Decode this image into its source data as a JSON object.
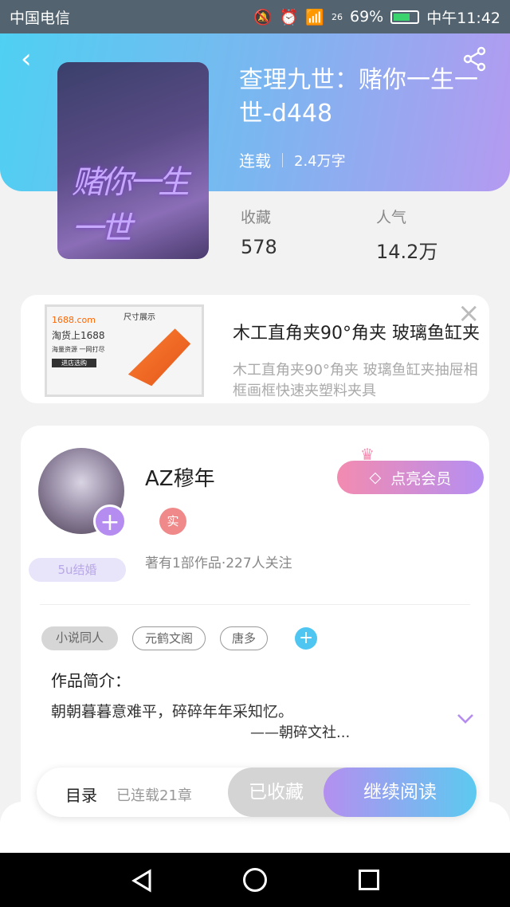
{
  "status_bar": {
    "carrier": "中国电信",
    "network": "26",
    "battery": "69%",
    "time": "中午11:42"
  },
  "book": {
    "title": "查理九世：赌你一生一世-d448",
    "status": "连载",
    "word_count": "2.4万字",
    "cover_text": "赌你一生一世"
  },
  "stats": {
    "favorites_label": "收藏",
    "favorites_value": "578",
    "popularity_label": "人气",
    "popularity_value": "14.2万"
  },
  "ad": {
    "image_brand": "1688.com",
    "image_headline": "淘货上1688",
    "image_sub": "海量资源 一网打尽",
    "image_button": "进店选购",
    "image_caption": "尺寸展示",
    "title": "木工直角夹90°角夹 玻璃鱼缸夹",
    "description": "木工直角夹90°角夹 玻璃鱼缸夹抽屉相框画框快速夹塑料夹具"
  },
  "author": {
    "name": "AZ穆年",
    "verified_badge": "实",
    "badge_5u": "5u结婚",
    "vip_button": "点亮会员",
    "works_info": "著有1部作品·227人关注"
  },
  "tags": [
    "小说同人",
    "元鹤文阁",
    "唐多"
  ],
  "intro": {
    "label": "作品简介：",
    "line1": "朝朝暮暮意难平，碎碎年年采知忆。",
    "line2": "——朝碎文社..."
  },
  "actions": {
    "toc": "目录",
    "chapter_count": "已连载21章",
    "collected": "已收藏",
    "continue": "继续阅读"
  },
  "colors": {
    "accent_purple": "#b58cf0",
    "accent_blue": "#4fc6f2",
    "vip_pink": "#f38bb0"
  }
}
